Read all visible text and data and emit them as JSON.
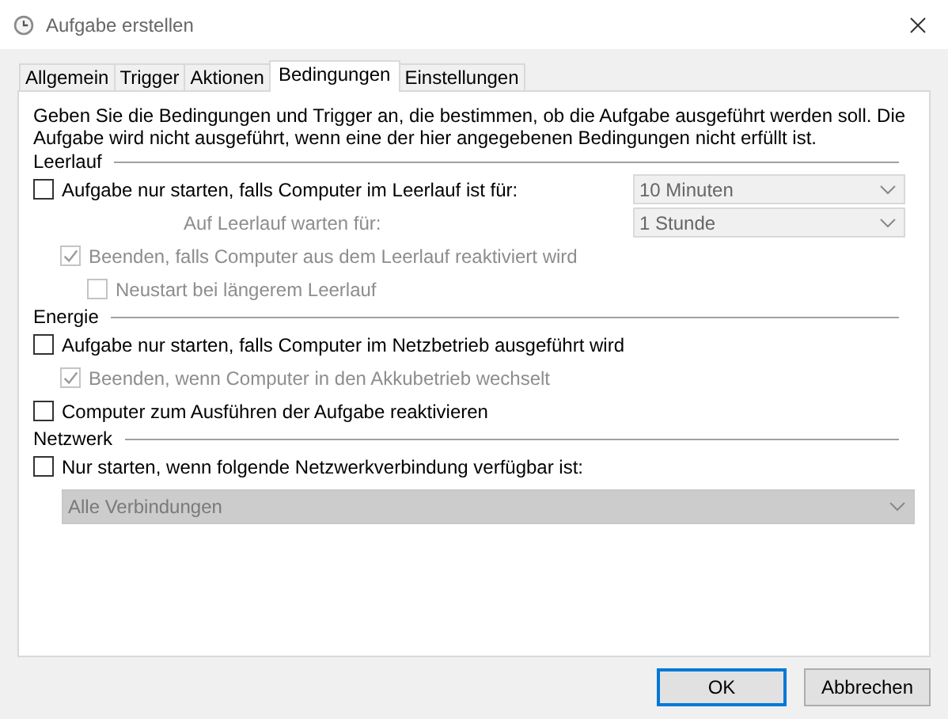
{
  "window": {
    "title": "Aufgabe erstellen"
  },
  "tabs": [
    {
      "label": "Allgemein",
      "selected": false
    },
    {
      "label": "Trigger",
      "selected": false
    },
    {
      "label": "Aktionen",
      "selected": false
    },
    {
      "label": "Bedingungen",
      "selected": true
    },
    {
      "label": "Einstellungen",
      "selected": false
    }
  ],
  "intro": "Geben Sie die Bedingungen und Trigger an, die bestimmen, ob die Aufgabe ausgeführt werden soll. Die Aufgabe wird nicht ausgeführt, wenn eine der hier angegebenen Bedingungen nicht erfüllt ist.",
  "sections": [
    {
      "title": "Leerlauf",
      "items": [
        {
          "kind": "checkbox",
          "label": "Aufgabe nur starten, falls Computer im Leerlauf ist für:",
          "checked": false,
          "disabled": false,
          "dropdown": {
            "value": "10 Minuten",
            "disabled": true
          },
          "children": [
            {
              "kind": "label",
              "label": "Auf Leerlauf warten für:",
              "disabled": true,
              "dropdown": {
                "value": "1 Stunde",
                "disabled": true
              }
            },
            {
              "kind": "checkbox",
              "label": "Beenden, falls Computer aus dem Leerlauf reaktiviert wird",
              "checked": true,
              "disabled": true,
              "children": [
                {
                  "kind": "checkbox",
                  "label": "Neustart bei längerem Leerlauf",
                  "checked": false,
                  "disabled": true
                }
              ]
            }
          ]
        }
      ]
    },
    {
      "title": "Energie",
      "items": [
        {
          "kind": "checkbox",
          "label": "Aufgabe nur starten, falls Computer im Netzbetrieb ausgeführt wird",
          "checked": false,
          "disabled": false,
          "children": [
            {
              "kind": "checkbox",
              "label": "Beenden, wenn Computer in den Akkubetrieb wechselt",
              "checked": true,
              "disabled": true
            }
          ]
        },
        {
          "kind": "checkbox",
          "label": "Computer zum Ausführen der Aufgabe reaktivieren",
          "checked": false,
          "disabled": false
        }
      ]
    },
    {
      "title": "Netzwerk",
      "items": [
        {
          "kind": "checkbox",
          "label": "Nur starten, wenn folgende Netzwerkverbindung verfügbar ist:",
          "checked": false,
          "disabled": false,
          "children": [
            {
              "kind": "dropdown",
              "value": "Alle Verbindungen",
              "disabled": true
            }
          ]
        }
      ]
    }
  ],
  "buttons": [
    {
      "label": "OK",
      "default": true
    },
    {
      "label": "Abbrechen",
      "default": false
    }
  ]
}
